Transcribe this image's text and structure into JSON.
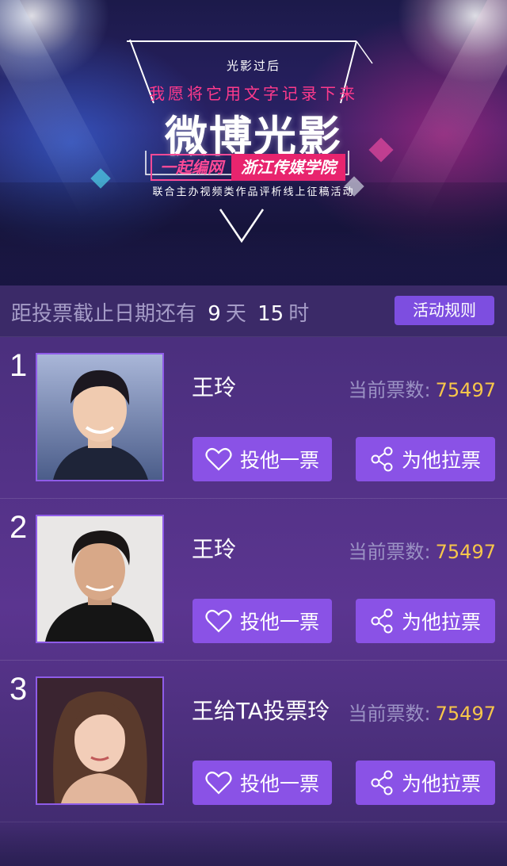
{
  "banner": {
    "line1": "光影过后",
    "line2": "我愿将它用文字记录下来",
    "title": "微博光影",
    "tag1": "一起编网",
    "tag2": "浙江传媒学院",
    "subtitle": "联合主办视频类作品评析线上征稿活动"
  },
  "countdown": {
    "prefix": "距投票截止日期还有",
    "days": "9",
    "days_unit": "天",
    "hours": "15",
    "hours_unit": "时",
    "rules_button": "活动规则"
  },
  "candidates": [
    {
      "rank": "1",
      "name": "王玲",
      "votes_label": "当前票数:",
      "votes": "75497",
      "vote_button": "投他一票",
      "share_button": "为他拉票"
    },
    {
      "rank": "2",
      "name": "王玲",
      "votes_label": "当前票数:",
      "votes": "75497",
      "vote_button": "投他一票",
      "share_button": "为他拉票"
    },
    {
      "rank": "3",
      "name": "王给TA投票玲",
      "votes_label": "当前票数:",
      "votes": "75497",
      "vote_button": "投他一票",
      "share_button": "为他拉票"
    }
  ],
  "icons": {
    "vote": "heart-icon",
    "share": "share-icon",
    "chevron": "chevron-down-icon"
  },
  "colors": {
    "accent": "#8a52e6",
    "votes_number": "#f7c64a",
    "banner_red": "#ff3a8c"
  }
}
